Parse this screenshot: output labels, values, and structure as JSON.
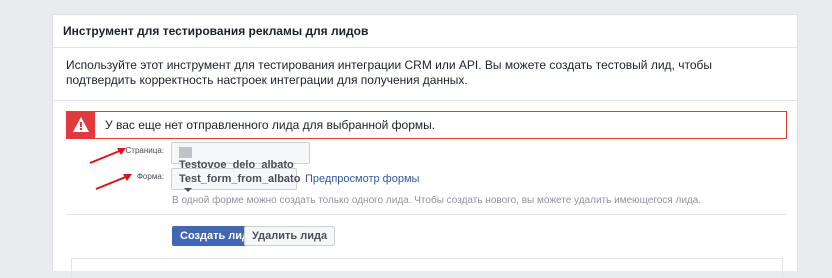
{
  "panel": {
    "title": "Инструмент для тестирования рекламы для лидов",
    "description": "Используйте этот инструмент для тестирования интеграции CRM или API. Вы можете создать тестовый лид, чтобы подтвердить корректность настроек интеграции для получения данных."
  },
  "alert": {
    "icon": "warning-icon",
    "text": "У вас еще нет отправленного лида для выбранной формы.",
    "color": "#e0393e"
  },
  "form": {
    "page_label": "Страница:",
    "page_value": "Testovoe_delo_albato",
    "form_label": "Форма:",
    "form_value": "Test_form_from_albato",
    "preview_link": "Предпросмотр формы",
    "hint": "В одной форме можно создать только одного лида. Чтобы создать нового, вы можете удалить имеющегося лида."
  },
  "actions": {
    "create_label": "Создать лид",
    "delete_label": "Удалить лида"
  },
  "colors": {
    "accent": "#4267b2",
    "link": "#365899",
    "annotation_arrow": "#e0111a"
  }
}
